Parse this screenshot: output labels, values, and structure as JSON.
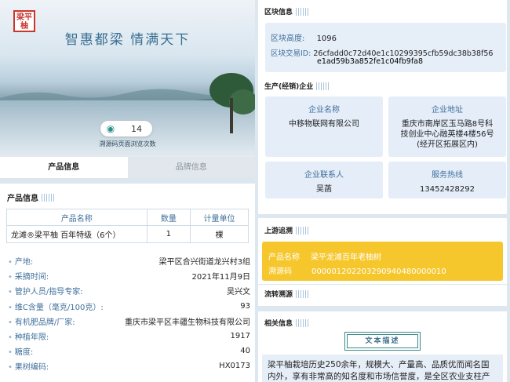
{
  "hero": {
    "seal_text": "梁平柚",
    "slogan": "智惠都梁 情满天下",
    "view_count": "14",
    "view_note": "溯源码页面浏览次数"
  },
  "tabs": [
    {
      "label": "产品信息",
      "active": true
    },
    {
      "label": "品牌信息",
      "active": false
    }
  ],
  "product": {
    "title": "产品信息",
    "table": {
      "headers": [
        "产品名称",
        "数量",
        "计量单位"
      ],
      "rows": [
        [
          "龙滩®梁平柚 百年特级（6个）",
          "1",
          "棵"
        ]
      ]
    },
    "details": [
      {
        "k": "产地:",
        "v": "梁平区合兴街道龙兴村3组"
      },
      {
        "k": "采摘时间:",
        "v": "2021年11月9日"
      },
      {
        "k": "管护人员/指导专家:",
        "v": "吴兴文"
      },
      {
        "k": "维C含量（毫克/100克）:",
        "v": "93"
      },
      {
        "k": "有机肥品牌/厂家:",
        "v": "重庆市梁平区丰疆生物科技有限公司"
      },
      {
        "k": "种植年限:",
        "v": "1917"
      },
      {
        "k": "糖度:",
        "v": "40"
      },
      {
        "k": "果树编码:",
        "v": "HX0173"
      }
    ]
  },
  "block": {
    "title": "区块信息",
    "height_label": "区块高度:",
    "height_value": "1096",
    "tx_label": "区块交易ID:",
    "tx_value_1": "26cfadd0c72d40e1c10299395cfb59dc38b38f56",
    "tx_value_2": "e1ad59b3a852fe1c04fb9fa8"
  },
  "enterprise": {
    "title": "生产(经销)企业",
    "name_label": "企业名称",
    "name_value": "中移物联网有限公司",
    "addr_label": "企业地址",
    "addr_value_1": "重庆市南岸区玉马路8号科",
    "addr_value_2": "技创业中心融英楼4楼56号",
    "addr_value_3": "(经开区拓展区内)",
    "contact_label": "企业联系人",
    "contact_value": "吴菡",
    "hotline_label": "服务热线",
    "hotline_value": "13452428292"
  },
  "upstream": {
    "title": "上游追溯",
    "product_label": "产品名称",
    "product_value": "梁平龙滩百年老柚树",
    "trace_label": "溯源码",
    "trace_value": "000001202203290940480000010"
  },
  "circulation": {
    "title": "流转溯源"
  },
  "related": {
    "title": "相关信息",
    "button": "文本描述",
    "text_1": "梁平柚栽培历史250余年，规模大、产量高、品质优而闻名国",
    "text_2": "内外，享有非常高的知名度和市场信誉度，是全区农业支柱产"
  },
  "colors": {
    "accent": "#3f6f9b",
    "yellow": "#f6c72d",
    "panel": "#e6eef8"
  }
}
